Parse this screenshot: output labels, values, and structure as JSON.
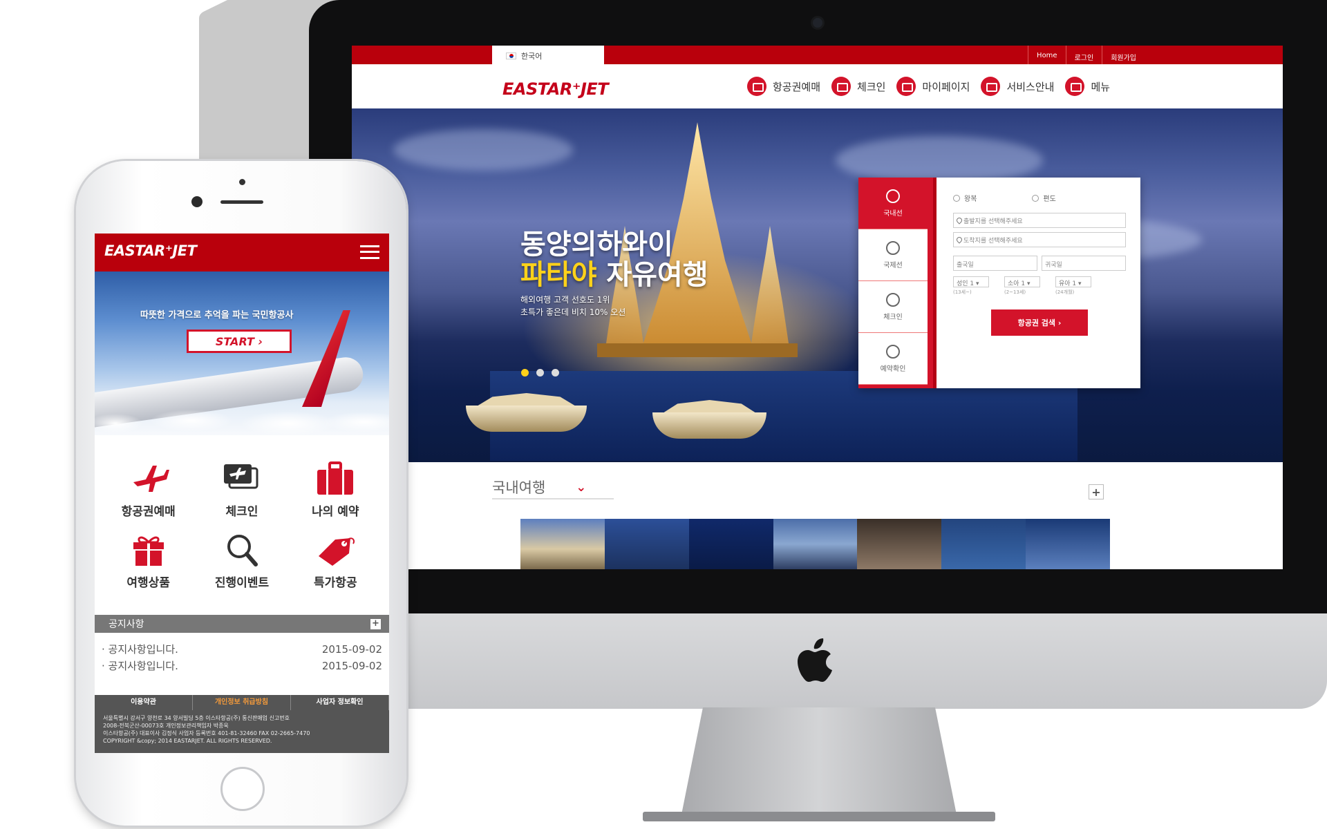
{
  "desktop": {
    "lang_label": "한국어",
    "util_links": [
      "Home",
      "로그인",
      "회원가입"
    ],
    "logo": "EASTAR⁺JET",
    "nav": [
      "항공권예매",
      "체크인",
      "마이페이지",
      "서비스안내",
      "메뉴"
    ],
    "hero": {
      "title_line1": "동양의하와이",
      "title_highlight": "파타야",
      "title_line2_rest": " 자유여행",
      "sub_line1": "해외여행 고객 선호도 1위",
      "sub_line2": "초특가 좋은데 비치 10% 오션"
    },
    "booking": {
      "tabs": [
        "국내선",
        "국제선",
        "체크인",
        "예약확인"
      ],
      "trip_types": [
        "왕복",
        "편도"
      ],
      "depart_placeholder": "출발지를 선택해주세요",
      "arrive_placeholder": "도착지를 선택해주세요",
      "depart_date": "출국일",
      "return_date": "귀국일",
      "passengers": [
        {
          "label": "성인 1 ▾",
          "note": "(13세~)"
        },
        {
          "label": "소아 1 ▾",
          "note": "(2~13세)"
        },
        {
          "label": "유아 1 ▾",
          "note": "(24개월)"
        }
      ],
      "search_label": "항공권 검색 ›"
    },
    "domestic_label": "국내여행",
    "colors": {
      "brand_red": "#d3132a",
      "dark_red": "#b9000c",
      "highlight_yellow": "#ffd21a"
    }
  },
  "mobile": {
    "logo": "EASTAR⁺JET",
    "tagline": "따뜻한 가격으로 추억을 파는 국민항공사",
    "start_label": "START ›",
    "menu": [
      {
        "label": "항공권예매",
        "icon": "airplane-icon"
      },
      {
        "label": "체크인",
        "icon": "ticket-icon"
      },
      {
        "label": "나의 예약",
        "icon": "suitcase-icon"
      },
      {
        "label": "여행상품",
        "icon": "gift-icon"
      },
      {
        "label": "진행이벤트",
        "icon": "magnifier-icon"
      },
      {
        "label": "특가항공",
        "icon": "price-tag-icon"
      }
    ],
    "notice_title": "공지사항",
    "notices": [
      {
        "text": "· 공지사항입니다.",
        "date": "2015-09-02"
      },
      {
        "text": "· 공지사항입니다.",
        "date": "2015-09-02"
      }
    ],
    "footer_tabs": [
      "이용약관",
      "개인정보 취급방침",
      "사업자 정보확인"
    ],
    "footer_lines": [
      "서울특별시 강서구 양천로 34 양서빌딩 5층 이스타항공(주) 통신판매업 신고번호",
      "2008-전북군산-00073호 개인정보관리책임자 박종욱",
      "이스타항공(주) 대표이사 김정식 사업자 등록번호 401-81-32460 FAX 02-2665-7470",
      "COPYRIGHT &copy; 2014 EASTARJET. ALL RIGHTS RESERVED."
    ]
  }
}
